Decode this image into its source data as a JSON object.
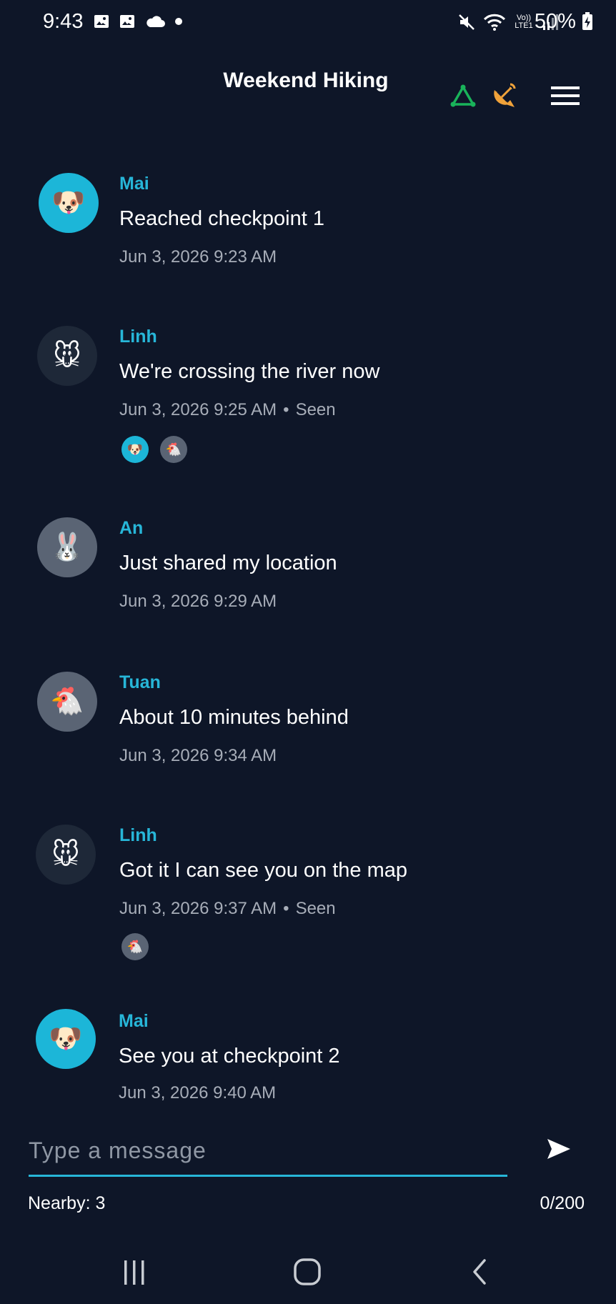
{
  "status_bar": {
    "time": "9:43",
    "battery": "50%",
    "lte_label": "Vo)) LTE1"
  },
  "header": {
    "title": "Weekend Hiking"
  },
  "messages": [
    {
      "sender": "Mai",
      "avatar": "🐶",
      "avatar_bg": "#1cb6d8",
      "text": "Reached checkpoint 1",
      "time": "Jun 3, 2026 9:23 AM",
      "status": "",
      "seen_by": []
    },
    {
      "sender": "Linh",
      "avatar": "🐭",
      "avatar_bg": "#1e2838",
      "text": "We're crossing the river now",
      "time": "Jun 3, 2026 9:25 AM",
      "status": "Seen",
      "seen_by": [
        {
          "avatar": "🐶",
          "bg": "#1cb6d8"
        },
        {
          "avatar": "🐔",
          "bg": "#5a6474"
        }
      ]
    },
    {
      "sender": "An",
      "avatar": "🐰",
      "avatar_bg": "#5a6474",
      "text": "Just shared my location",
      "time": "Jun 3, 2026 9:29 AM",
      "status": "",
      "seen_by": []
    },
    {
      "sender": "Tuan",
      "avatar": "🐔",
      "avatar_bg": "#5a6474",
      "text": "About 10 minutes behind",
      "time": "Jun 3, 2026 9:34 AM",
      "status": "",
      "seen_by": []
    },
    {
      "sender": "Linh",
      "avatar": "🐭",
      "avatar_bg": "#1e2838",
      "text": "Got it I can see you on the map",
      "time": "Jun 3, 2026 9:37 AM",
      "status": "Seen",
      "seen_by": [
        {
          "avatar": "🐔",
          "bg": "#5a6474"
        }
      ]
    },
    {
      "sender": "Mai",
      "avatar": "🐶",
      "avatar_bg": "#1cb6d8",
      "text": "See you at checkpoint 2",
      "time": "Jun 3, 2026 9:40 AM",
      "status": "",
      "seen_by": []
    }
  ],
  "composer": {
    "placeholder": "Type a message",
    "value": "",
    "nearby": "Nearby: 3",
    "char_count": "0/200"
  },
  "colors": {
    "background": "#0e1628",
    "accent": "#27b6d8",
    "network_icon": "#19b35a",
    "satellite_icon": "#f0a23a"
  },
  "icons": {
    "network": "network-triangle-icon",
    "satellite": "satellite-dish-icon",
    "menu": "hamburger-menu-icon",
    "send": "send-icon"
  }
}
